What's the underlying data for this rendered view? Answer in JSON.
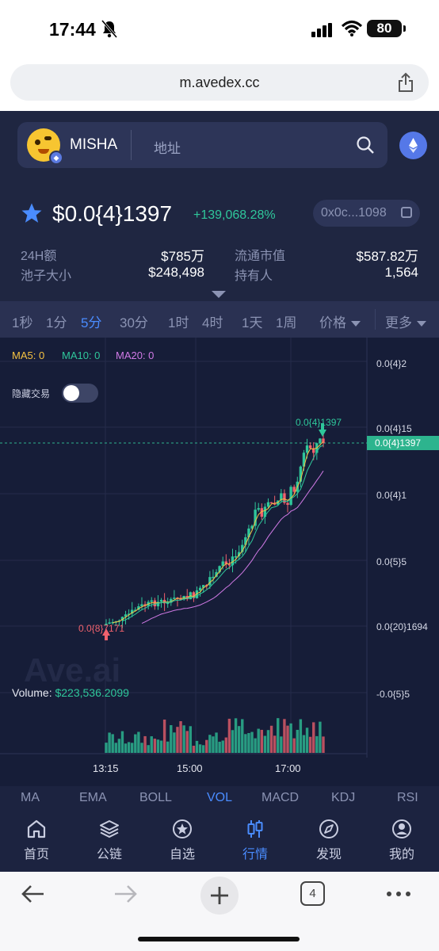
{
  "status_bar": {
    "time": "17:44",
    "battery": "80"
  },
  "browser": {
    "url": "m.avedex.cc",
    "tab_count": "4"
  },
  "header": {
    "token_name": "MISHA",
    "address_placeholder": "地址"
  },
  "price": {
    "value": "$0.0{4}1397",
    "change": "+139,068.28%",
    "contract": "0x0c...1098"
  },
  "stats": {
    "vol24h_label": "24H额",
    "vol24h_value": "$785万",
    "circ_mcap_label": "流通市值",
    "circ_mcap_value": "$587.82万",
    "pool_label": "池子大小",
    "pool_value": "$248,498",
    "holders_label": "持有人",
    "holders_value": "1,564"
  },
  "timeframes": [
    "1秒",
    "1分",
    "5分",
    "30分",
    "1时",
    "4时",
    "1天",
    "1周"
  ],
  "timeframe_active": "5分",
  "menu": {
    "price_label": "价格",
    "more_label": "更多"
  },
  "chart": {
    "ma5": "MA5: 0",
    "ma10": "MA10: 0",
    "ma20": "MA20: 0",
    "hide_trades": "隐藏交易",
    "high_label": "0.0{4}1397",
    "low_label": "0.0{8}7171",
    "current_label": "0.0{4}1397",
    "watermark": "Ave.ai",
    "volume_label": "Volume:",
    "volume_value": "$223,536.2099",
    "colors": {
      "up": "#2fc79b",
      "down": "#f0616d",
      "ma5": "#f5c242",
      "ma10": "#2fc79b",
      "ma20": "#d17ae6"
    }
  },
  "chart_data": {
    "type": "candlestick",
    "title": "",
    "y_tick_labels": [
      "0.0{4}2",
      "0.0{4}15",
      "0.0{4}1",
      "0.0{5}5",
      "0.0{20}1694",
      "-0.0{5}5"
    ],
    "x_tick_labels": [
      "13:15",
      "15:00",
      "17:00"
    ],
    "ylim": [
      -5e-06,
      2e-05
    ],
    "series": [
      {
        "name": "price_close_approx",
        "values": [
          2e-07,
          6e-07,
          1.5e-06,
          1.8e-06,
          2e-06,
          2.2e-06,
          3e-06,
          4.5e-06,
          5.8e-06,
          8.5e-06,
          9.2e-06,
          9.8e-06,
          1.35e-05,
          1.39e-05
        ]
      }
    ]
  },
  "indicators": [
    "MA",
    "EMA",
    "BOLL",
    "VOL",
    "MACD",
    "KDJ",
    "RSI"
  ],
  "indicator_active": "VOL",
  "nav": [
    {
      "label": "首页",
      "icon": "home-icon"
    },
    {
      "label": "公链",
      "icon": "layers-icon"
    },
    {
      "label": "自选",
      "icon": "star-circle-icon"
    },
    {
      "label": "行情",
      "icon": "candles-icon"
    },
    {
      "label": "发现",
      "icon": "compass-icon"
    },
    {
      "label": "我的",
      "icon": "user-icon"
    }
  ],
  "nav_active": "行情"
}
